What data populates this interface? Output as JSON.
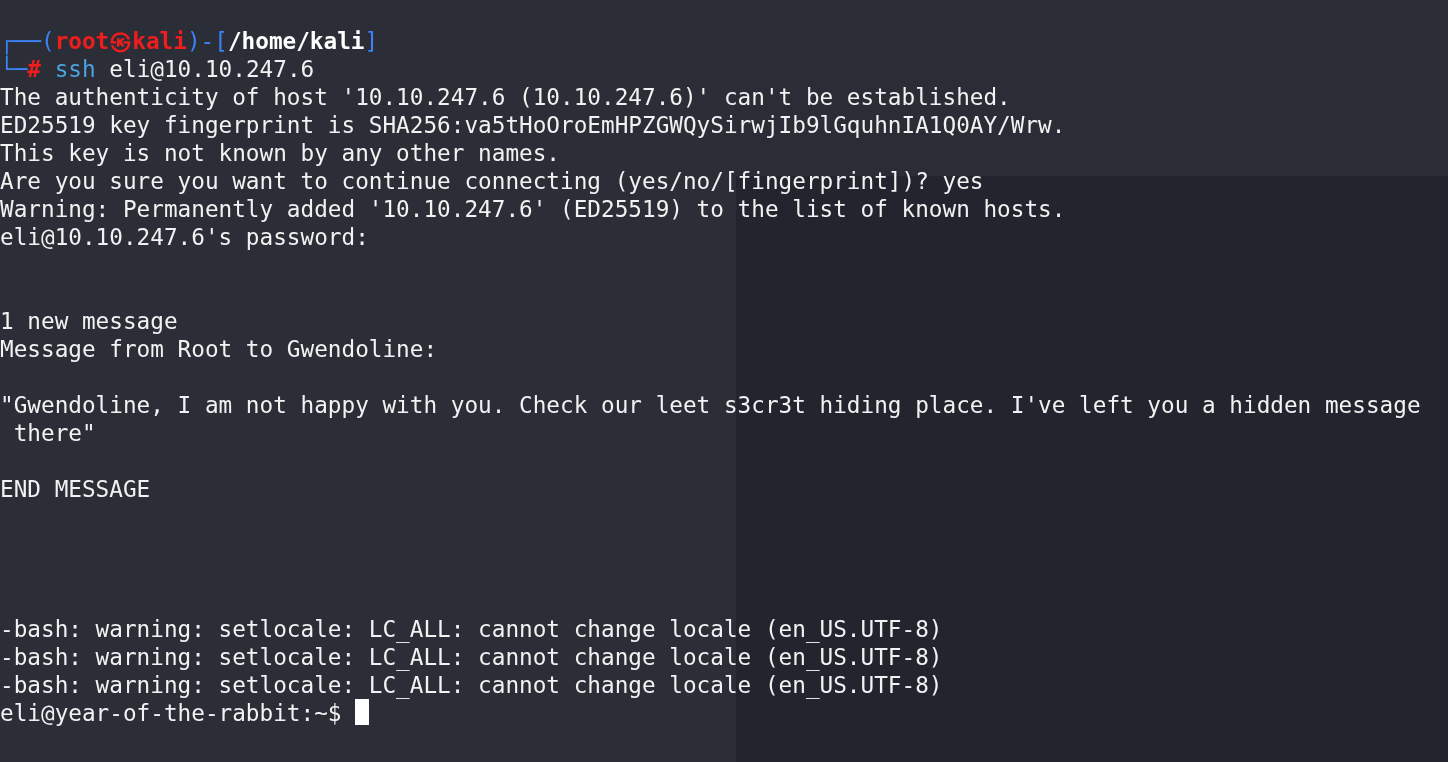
{
  "prompt": {
    "corner_top": "┌──(",
    "user_host": "root㉿kali",
    "bracket_open": ")-[",
    "path": "/home/kali",
    "bracket_close": "]",
    "corner_bottom": "└─",
    "symbol": "#",
    "command": "ssh",
    "args": "eli@10.10.247.6"
  },
  "lines": [
    {
      "kind": "output",
      "text": "The authenticity of host '10.10.247.6 (10.10.247.6)' can't be established."
    },
    {
      "kind": "output",
      "text": "ED25519 key fingerprint is SHA256:va5tHoOroEmHPZGWQySirwjIb9lGquhnIA1Q0AY/Wrw."
    },
    {
      "kind": "output",
      "text": "This key is not known by any other names."
    },
    {
      "kind": "output",
      "text": "Are you sure you want to continue connecting (yes/no/[fingerprint])? yes"
    },
    {
      "kind": "output",
      "text": "Warning: Permanently added '10.10.247.6' (ED25519) to the list of known hosts."
    },
    {
      "kind": "output",
      "text": "eli@10.10.247.6's password:"
    },
    {
      "kind": "blank"
    },
    {
      "kind": "blank"
    },
    {
      "kind": "output",
      "text": "1 new message"
    },
    {
      "kind": "output",
      "text": "Message from Root to Gwendoline:"
    },
    {
      "kind": "blank"
    },
    {
      "kind": "output",
      "text": "\"Gwendoline, I am not happy with you. Check our leet s3cr3t hiding place. I've left you a hidden message"
    },
    {
      "kind": "output",
      "text": " there\""
    },
    {
      "kind": "blank"
    },
    {
      "kind": "output",
      "text": "END MESSAGE"
    },
    {
      "kind": "blank"
    },
    {
      "kind": "blank"
    },
    {
      "kind": "blank"
    },
    {
      "kind": "blank"
    },
    {
      "kind": "output",
      "text": "-bash: warning: setlocale: LC_ALL: cannot change locale (en_US.UTF-8)"
    },
    {
      "kind": "output",
      "text": "-bash: warning: setlocale: LC_ALL: cannot change locale (en_US.UTF-8)"
    },
    {
      "kind": "output",
      "text": "-bash: warning: setlocale: LC_ALL: cannot change locale (en_US.UTF-8)"
    }
  ],
  "final_prompt": "eli@year-of-the-rabbit:~$"
}
